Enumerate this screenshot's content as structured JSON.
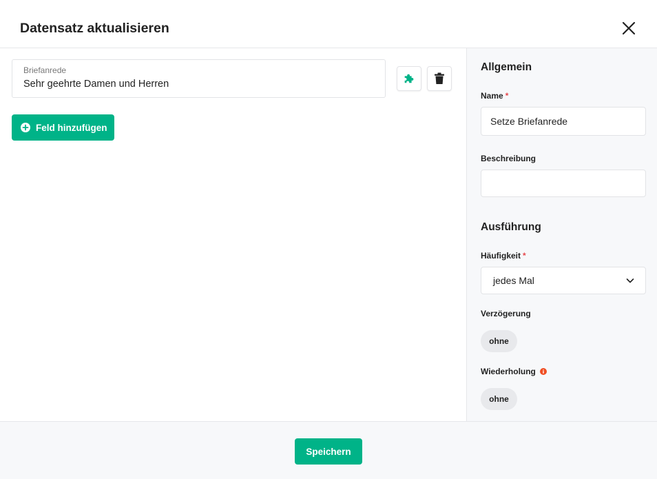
{
  "dialog": {
    "title": "Datensatz aktualisieren"
  },
  "fields": [
    {
      "label": "Briefanrede",
      "value": "Sehr geehrte Damen und Herren"
    }
  ],
  "actions": {
    "add_field_label": "Feld hinzufügen",
    "save_label": "Speichern"
  },
  "sidebar": {
    "general": {
      "title": "Allgemein",
      "name_label": "Name",
      "name_required": "*",
      "name_value": "Setze Briefanrede",
      "description_label": "Beschreibung",
      "description_value": ""
    },
    "execution": {
      "title": "Ausführung",
      "frequency_label": "Häufigkeit",
      "frequency_required": "*",
      "frequency_value": "jedes Mal",
      "delay_label": "Verzögerung",
      "delay_value": "ohne",
      "repeat_label": "Wiederholung",
      "repeat_value": "ohne"
    }
  },
  "colors": {
    "accent": "#00b388",
    "required": "#e5484d",
    "info": "#f04e23",
    "panel_bg": "#f7f8fa"
  },
  "icons": {
    "close": "close-icon",
    "plugin": "puzzle-icon",
    "delete": "trash-icon",
    "add": "plus-circle-icon",
    "dropdown": "chevron-down-icon",
    "info": "info-icon"
  }
}
